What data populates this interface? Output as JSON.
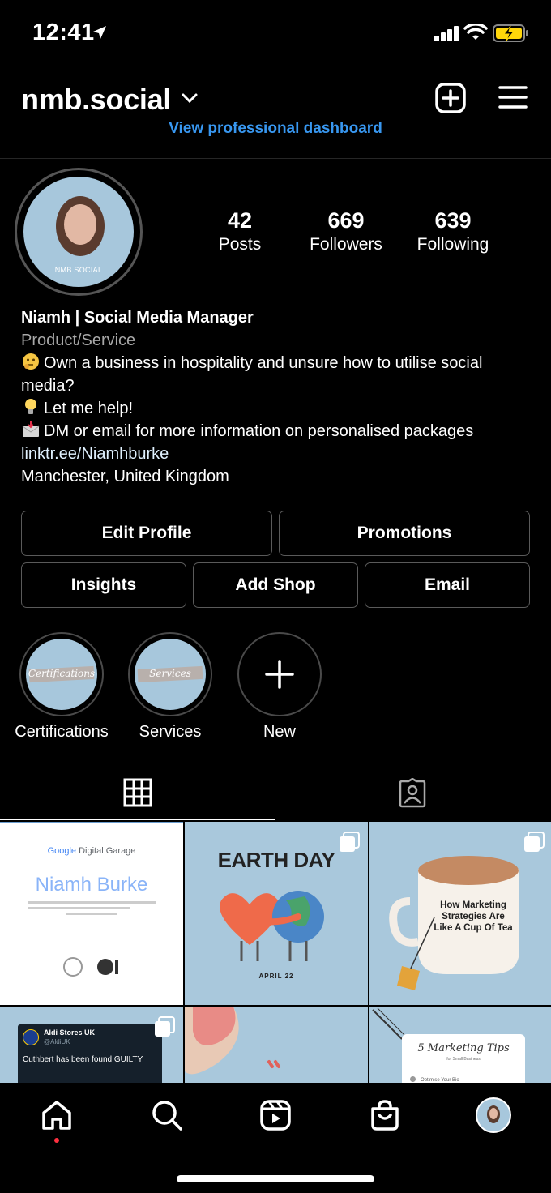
{
  "status_bar": {
    "time": "12:41"
  },
  "header": {
    "username": "nmb.social",
    "professional_dashboard": "View professional dashboard"
  },
  "profile": {
    "avatar_caption": "NMB SOCIAL",
    "stats": {
      "posts": {
        "value": "42",
        "label": "Posts"
      },
      "followers": {
        "value": "669",
        "label": "Followers"
      },
      "following": {
        "value": "639",
        "label": "Following"
      }
    },
    "bio": {
      "name": "Niamh | Social Media Manager",
      "category": "Product/Service",
      "line1": "Own a business in hospitality and unsure how to utilise social media?",
      "line2": "Let me help!",
      "line3": "DM or email for more information on personalised packages",
      "link": "linktr.ee/Niamhburke",
      "location": "Manchester, United Kingdom"
    }
  },
  "buttons": {
    "edit_profile": "Edit Profile",
    "promotions": "Promotions",
    "insights": "Insights",
    "add_shop": "Add Shop",
    "email": "Email"
  },
  "highlights": [
    {
      "label": "Certifications",
      "cover_text": "Certifications"
    },
    {
      "label": "Services",
      "cover_text": "Services"
    },
    {
      "label": "New"
    }
  ],
  "posts": {
    "cert": {
      "brand_prefix": "Google",
      "brand": "Digital Garage",
      "name": "Niamh Burke"
    },
    "earth_day": {
      "title": "EARTH DAY",
      "date": "APRIL 22"
    },
    "mug": {
      "text": "How Marketing Strategies Are Like A Cup Of Tea"
    },
    "aldi": {
      "name": "Aldi Stores UK",
      "handle": "@AldiUK",
      "text": "Cuthbert has been found GUILTY"
    },
    "tips": {
      "title": "5 Marketing Tips",
      "subtitle": "for Small Business",
      "item": "Optimise Your Bio"
    }
  },
  "colors": {
    "accent_link": "#3897f0",
    "notification_dot": "#ff3040",
    "brand_blue": "#a7c7dc"
  }
}
